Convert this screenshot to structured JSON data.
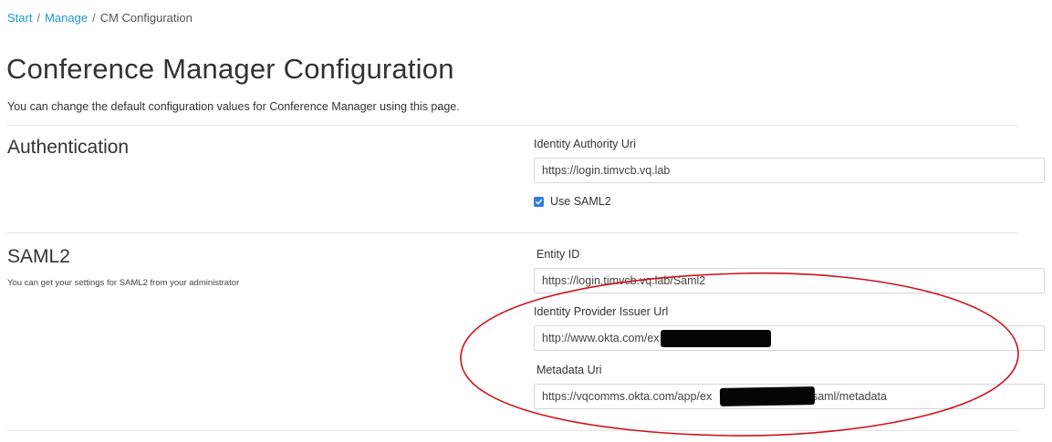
{
  "breadcrumb": {
    "start": "Start",
    "separator": "/",
    "manage": "Manage",
    "current": "CM Configuration"
  },
  "page": {
    "title": "Conference Manager Configuration",
    "description": "You can change the default configuration values for Conference Manager using this page."
  },
  "authentication": {
    "section_title": "Authentication",
    "identity_authority_uri_label": "Identity Authority Uri",
    "identity_authority_uri_value": "https://login.timvcb.vq.lab",
    "use_saml2_label": "Use SAML2",
    "use_saml2_checked": true
  },
  "saml2": {
    "section_title": "SAML2",
    "section_description": "You can get your settings for SAML2 from your administrator",
    "entity_id_label": "Entity ID",
    "entity_id_value": "https://login.timvcb.vq.lab/Saml2",
    "idp_issuer_url_label": "Identity Provider Issuer Url",
    "idp_issuer_url_value": "http://www.okta.com/ex",
    "metadata_uri_label": "Metadata Uri",
    "metadata_uri_value": "https://vqcomms.okta.com/app/ex                    56/sso/saml/metadata"
  },
  "colors": {
    "link": "#1a9ac9",
    "checkbox": "#2a7ee0",
    "annotation_circle": "#d0101a",
    "redaction": "#050505"
  }
}
